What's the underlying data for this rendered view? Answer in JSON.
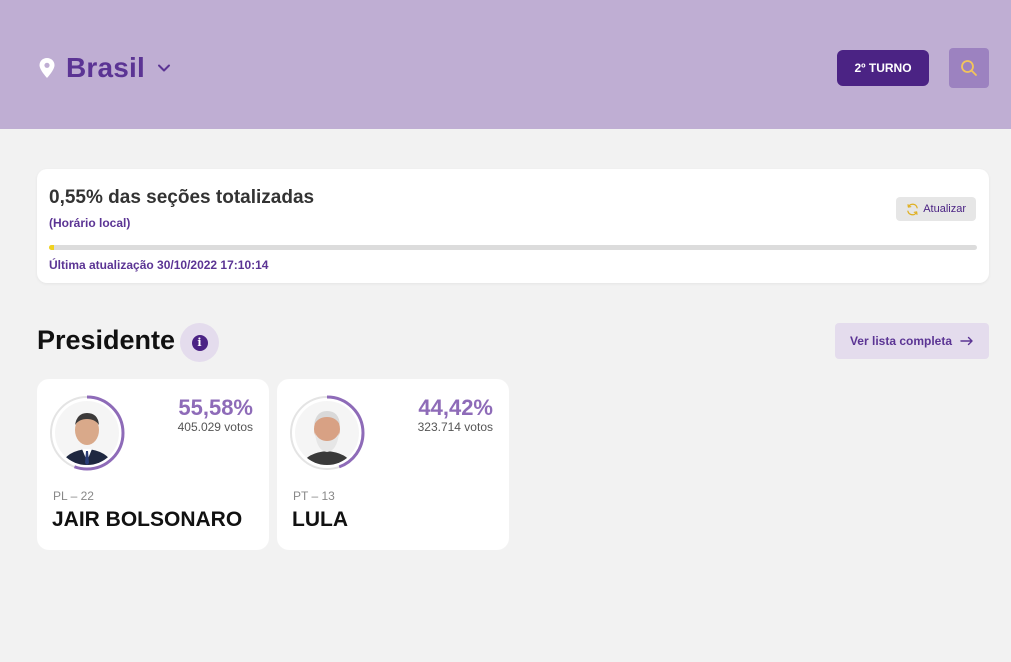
{
  "header": {
    "location": "Brasil",
    "turno_label": "2º TURNO"
  },
  "status": {
    "percent_text": "0,55% das seções totalizadas",
    "local_time_note": "(Horário local)",
    "refresh_label": "Atualizar",
    "progress_percent": 0.55,
    "last_update": "Última atualização 30/10/2022 17:10:14"
  },
  "section": {
    "title": "Presidente",
    "see_all_label": "Ver lista completa"
  },
  "candidates": [
    {
      "percent": "55,58%",
      "votes": "405.029 votos",
      "party": "PL – 22",
      "name": "JAIR BOLSONARO",
      "share": 55.58
    },
    {
      "percent": "44,42%",
      "votes": "323.714 votos",
      "party": "PT – 13",
      "name": "LULA",
      "share": 44.42
    }
  ],
  "colors": {
    "header_bg": "#bfaed3",
    "primary": "#4b2384",
    "accent": "#8e6bb8",
    "progress_fill": "#f0d220"
  }
}
